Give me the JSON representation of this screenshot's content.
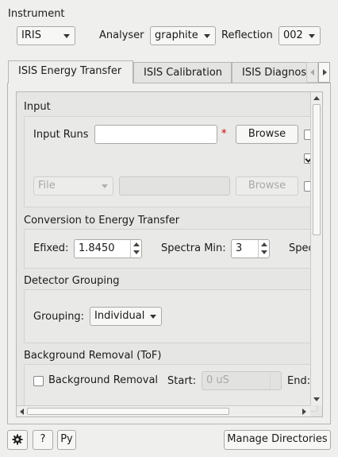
{
  "instrument": {
    "section_label": "Instrument",
    "instrument_value": "IRIS",
    "analyser_label": "Analyser",
    "analyser_value": "graphite",
    "reflection_label": "Reflection",
    "reflection_value": "002"
  },
  "tabs": [
    {
      "label": "ISIS Energy Transfer",
      "active": true
    },
    {
      "label": "ISIS Calibration",
      "active": false
    },
    {
      "label": "ISIS Diagnos",
      "active": false
    }
  ],
  "input": {
    "section_label": "Input",
    "runs_label": "Input Runs",
    "runs_value": "",
    "required_marker": "*",
    "browse_label": "Browse",
    "file_combo_value": "File",
    "file_value": "",
    "browse2_label": "Browse"
  },
  "conversion": {
    "section_label": "Conversion to Energy Transfer",
    "efixed_label": "Efixed:",
    "efixed_value": "1.8450",
    "spectra_min_label": "Spectra Min:",
    "spectra_min_value": "3",
    "spectra_max_label_partial": "Spec"
  },
  "grouping": {
    "section_label": "Detector Grouping",
    "grouping_label": "Grouping:",
    "grouping_value": "Individual"
  },
  "background": {
    "section_label": "Background Removal (ToF)",
    "checkbox_label": "Background Removal",
    "start_label": "Start:",
    "start_placeholder": "0 uS",
    "end_label": "End:"
  },
  "footer": {
    "help_label": "?",
    "py_label": "Py",
    "manage_dirs_label": "Manage Directories"
  },
  "icons": {
    "settings": "gear-icon",
    "tab_scroll_left": "chevron-left-icon",
    "tab_scroll_right": "chevron-right-icon"
  }
}
